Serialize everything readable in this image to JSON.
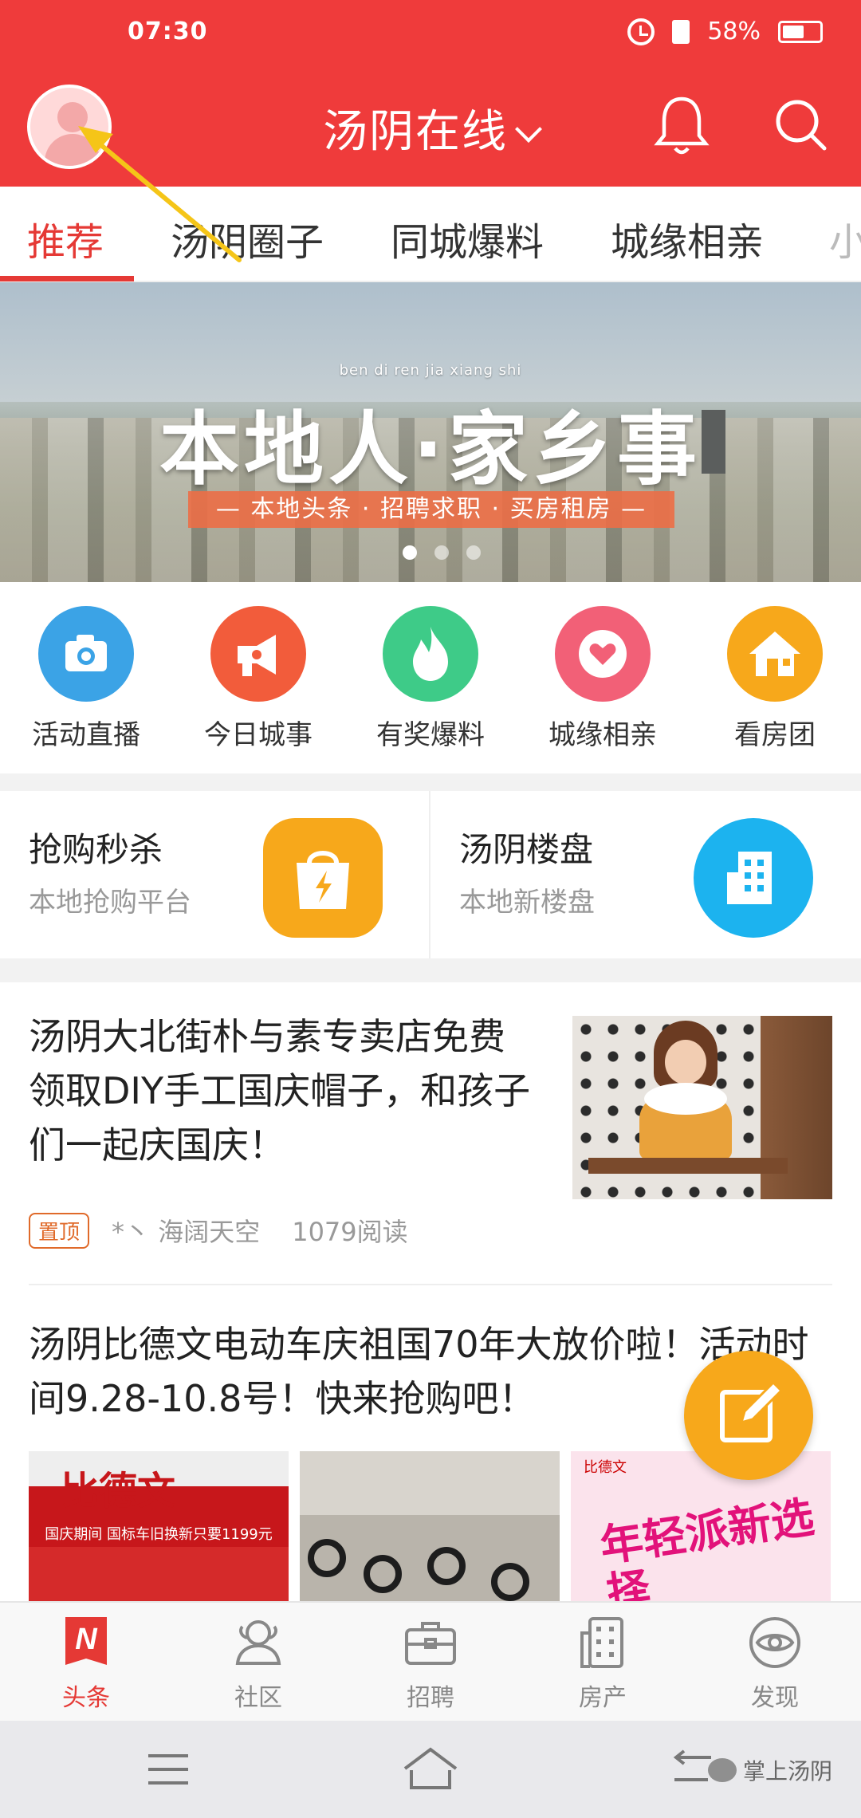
{
  "status_bar": {
    "time": "07:30",
    "battery": "58%"
  },
  "header": {
    "title": "汤阴在线"
  },
  "tabs": [
    {
      "label": "推荐",
      "active": true
    },
    {
      "label": "汤阴圈子"
    },
    {
      "label": "同城爆料"
    },
    {
      "label": "城缘相亲"
    },
    {
      "label": "小"
    }
  ],
  "banner": {
    "pinyin": "ben di ren jia xiang shi",
    "headline": "本地人·家乡事",
    "tagline": "— 本地头条 · 招聘求职 · 买房租房 —",
    "slide_count": 3,
    "active_slide": 0
  },
  "quick_links": [
    {
      "label": "活动直播",
      "icon": "camera-icon",
      "color": "#3ba3e6"
    },
    {
      "label": "今日城事",
      "icon": "megaphone-icon",
      "color": "#f25c3b"
    },
    {
      "label": "有奖爆料",
      "icon": "flame-icon",
      "color": "#3ecb88"
    },
    {
      "label": "城缘相亲",
      "icon": "heart-chat-icon",
      "color": "#f26077"
    },
    {
      "label": "看房团",
      "icon": "house-icon",
      "color": "#f7a81b"
    }
  ],
  "promo": [
    {
      "title": "抢购秒杀",
      "subtitle": "本地抢购平台",
      "icon": "shopping-bag-icon",
      "color": "#f7a81b"
    },
    {
      "title": "汤阴楼盘",
      "subtitle": "本地新楼盘",
      "icon": "building-icon",
      "color": "#1cb3ef"
    }
  ],
  "articles": [
    {
      "title": "汤阴大北街朴与素专卖店免费领取DIY手工国庆帽子，和孩子们一起庆国庆！",
      "pinned_label": "置顶",
      "author": "*丶 海阔天空",
      "reads": "1079阅读"
    },
    {
      "title": "汤阴比德文电动车庆祖国70年大放价啦！活动时间9.28-10.8号！快来抢购吧！",
      "images": [
        {
          "sign": "比德文",
          "strip": "国庆期间 国标车旧换新只要1199元"
        },
        {
          "scene": "e-bikes"
        },
        {
          "brand": "比德文",
          "text": "年轻派新选择"
        }
      ]
    }
  ],
  "bottom_nav": [
    {
      "label": "头条",
      "icon": "headline-n-icon",
      "active": true
    },
    {
      "label": "社区",
      "icon": "community-icon"
    },
    {
      "label": "招聘",
      "icon": "briefcase-icon"
    },
    {
      "label": "房产",
      "icon": "building-grid-icon"
    },
    {
      "label": "发现",
      "icon": "eye-discover-icon"
    }
  ],
  "watermark": "掌上汤阴",
  "colors": {
    "brand_red": "#ef3b3b",
    "accent_orange": "#f7a81b"
  }
}
